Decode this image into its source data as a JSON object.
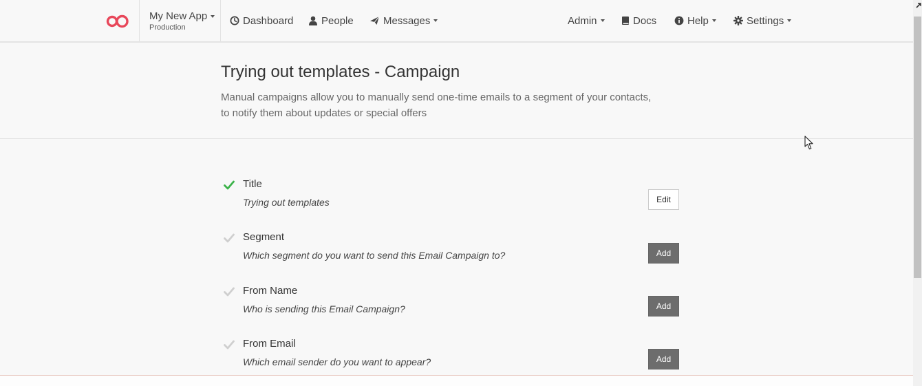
{
  "nav": {
    "app_name": "My New App",
    "app_env": "Production",
    "dashboard": "Dashboard",
    "people": "People",
    "messages": "Messages",
    "admin": "Admin",
    "docs": "Docs",
    "help": "Help",
    "settings": "Settings"
  },
  "header": {
    "title": "Trying out templates - Campaign",
    "description_line1": "Manual campaigns allow you to manually send one-time emails to a segment of your contacts,",
    "description_line2": "to notify them about updates or special offers"
  },
  "steps": [
    {
      "label": "Title",
      "value": "Trying out templates",
      "button": "Edit",
      "complete": true
    },
    {
      "label": "Segment",
      "value": "Which segment do you want to send this Email Campaign to?",
      "button": "Add",
      "complete": false
    },
    {
      "label": "From Name",
      "value": "Who is sending this Email Campaign?",
      "button": "Add",
      "complete": false
    },
    {
      "label": "From Email",
      "value": "Which email sender do you want to appear?",
      "button": "Add",
      "complete": false
    }
  ],
  "colors": {
    "brand": "#e8475a",
    "check_complete": "#3cb34a",
    "check_incomplete": "#cfcfcf",
    "add_button": "#6d6d6d"
  }
}
